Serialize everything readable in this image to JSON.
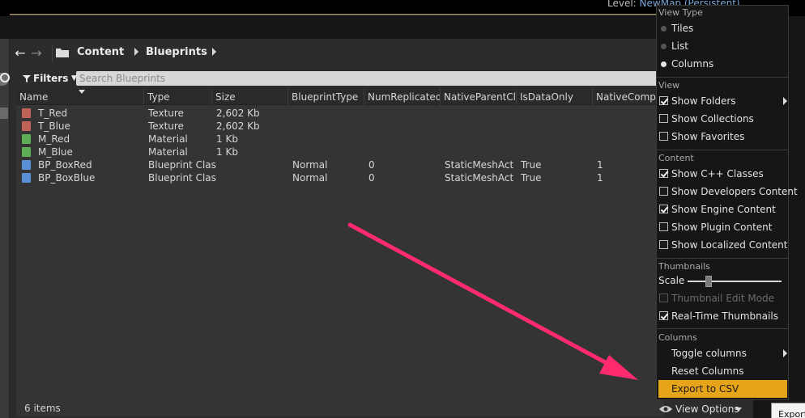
{
  "topbar": {
    "level_label": "Level:",
    "level_value": "NewMap (Persistent)"
  },
  "breadcrumb": {
    "items": [
      "Content",
      "Blueprints"
    ]
  },
  "filters": {
    "label": "Filters",
    "search_placeholder": "Search Blueprints"
  },
  "columns": [
    "Name",
    "Type",
    "Size",
    "BlueprintType",
    "NumReplicatedP",
    "NativeParentClas",
    "IsDataOnly",
    "NativeCompor"
  ],
  "rows": [
    {
      "name": "T_Red",
      "type": "Texture",
      "size": "2,602 Kb",
      "bp_type": "",
      "num_rep": "",
      "native_parent": "",
      "data_only": "",
      "native_comp": "",
      "icon_color": "#c0625a"
    },
    {
      "name": "T_Blue",
      "type": "Texture",
      "size": "2,602 Kb",
      "bp_type": "",
      "num_rep": "",
      "native_parent": "",
      "data_only": "",
      "native_comp": "",
      "icon_color": "#c0625a"
    },
    {
      "name": "M_Red",
      "type": "Material",
      "size": "1 Kb",
      "bp_type": "",
      "num_rep": "",
      "native_parent": "",
      "data_only": "",
      "native_comp": "",
      "icon_color": "#5fae55"
    },
    {
      "name": "M_Blue",
      "type": "Material",
      "size": "1 Kb",
      "bp_type": "",
      "num_rep": "",
      "native_parent": "",
      "data_only": "",
      "native_comp": "",
      "icon_color": "#5fae55"
    },
    {
      "name": "BP_BoxRed",
      "type": "Blueprint Clas",
      "size": "",
      "bp_type": "Normal",
      "num_rep": "0",
      "native_parent": "StaticMeshActo",
      "data_only": "True",
      "native_comp": "1",
      "icon_color": "#5a8fd6"
    },
    {
      "name": "BP_BoxBlue",
      "type": "Blueprint Clas",
      "size": "",
      "bp_type": "Normal",
      "num_rep": "0",
      "native_parent": "StaticMeshActo",
      "data_only": "True",
      "native_comp": "1",
      "icon_color": "#5a8fd6"
    }
  ],
  "item_count": "6 items",
  "menu": {
    "view_type_header": "View Type",
    "view_types": [
      "Tiles",
      "List",
      "Columns"
    ],
    "view_header": "View",
    "view_items": [
      {
        "label": "Show Folders",
        "checked": true
      },
      {
        "label": "Show Collections",
        "checked": false
      },
      {
        "label": "Show Favorites",
        "checked": false
      }
    ],
    "content_header": "Content",
    "content_items": [
      {
        "label": "Show C++ Classes",
        "checked": true
      },
      {
        "label": "Show Developers Content",
        "checked": false
      },
      {
        "label": "Show Engine Content",
        "checked": true
      },
      {
        "label": "Show Plugin Content",
        "checked": false
      },
      {
        "label": "Show Localized Content",
        "checked": false
      }
    ],
    "thumbnails_header": "Thumbnails",
    "scale_label": "Scale",
    "scale_value": 0.22,
    "thumb_edit_label": "Thumbnail Edit Mode",
    "realtime_label": "Real-Time Thumbnails",
    "columns_header": "Columns",
    "toggle_columns": "Toggle columns",
    "reset_columns": "Reset Columns",
    "export_csv": "Export to CSV"
  },
  "view_options_label": "View Options",
  "tooltip_text": "Export",
  "colors": {
    "highlight": "#e6a419",
    "arrow": "#ff2b6e"
  }
}
